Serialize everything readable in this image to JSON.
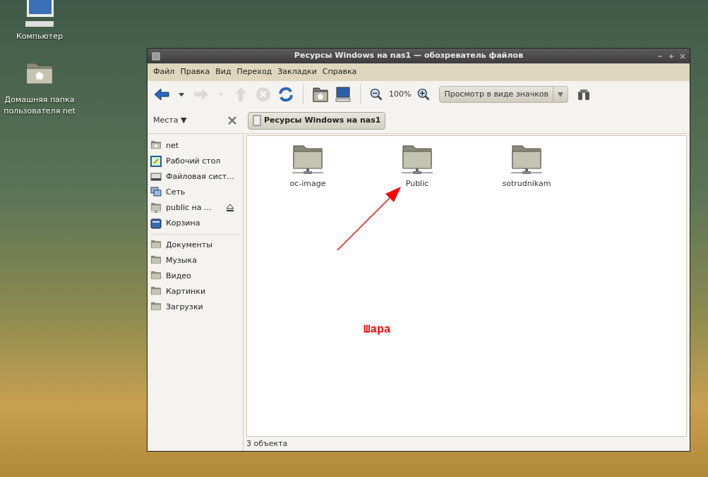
{
  "desktop_icons": [
    {
      "kind": "computer",
      "label": "Компьютер"
    },
    {
      "kind": "home",
      "label": "Домашняя папка пользователя net"
    }
  ],
  "window": {
    "title": "Ресурсы Windows на nas1 — обозреватель файлов"
  },
  "menu": [
    "Файл",
    "Правка",
    "Вид",
    "Переход",
    "Закладки",
    "Справка"
  ],
  "toolbar": [
    [
      {
        "kind": "back",
        "disabled": false
      },
      {
        "kind": "caret",
        "disabled": false
      },
      {
        "kind": "forward",
        "disabled": true
      },
      {
        "kind": "caret",
        "disabled": true
      },
      {
        "kind": "up",
        "disabled": true
      },
      {
        "kind": "stop",
        "disabled": true
      },
      {
        "kind": "reload",
        "disabled": false
      }
    ],
    [
      {
        "kind": "home",
        "disabled": false
      },
      {
        "kind": "computer",
        "disabled": false
      }
    ],
    [
      {
        "kind": "zoom-out",
        "disabled": false
      }
    ]
  ],
  "zoom": "100%",
  "view_select": "Просмотр в виде значков",
  "sidebar": {
    "title": "Места ▼",
    "groups": [
      [
        {
          "kind": "home",
          "label": "net",
          "eject": false
        },
        {
          "kind": "desktop",
          "label": "Рабочий стол",
          "eject": false
        },
        {
          "kind": "drive",
          "label": "Файловая сист…",
          "eject": false
        },
        {
          "kind": "network",
          "label": "Сеть",
          "eject": false
        },
        {
          "kind": "share",
          "label": "public на …",
          "eject": true
        },
        {
          "kind": "trash",
          "label": "Корзина",
          "eject": false
        }
      ],
      [
        {
          "kind": "folder",
          "label": "Документы",
          "eject": false
        },
        {
          "kind": "folder",
          "label": "Музыка",
          "eject": false
        },
        {
          "kind": "folder",
          "label": "Видео",
          "eject": false
        },
        {
          "kind": "folder",
          "label": "Картинки",
          "eject": false
        },
        {
          "kind": "folder",
          "label": "Загрузки",
          "eject": false
        }
      ]
    ]
  },
  "location_button": "Ресурсы Windows на nas1",
  "files": [
    {
      "name": "oc-image",
      "selected": false
    },
    {
      "name": "Public",
      "selected": false
    },
    {
      "name": "sotrudnikam",
      "selected": false
    }
  ],
  "annotation": "Шара",
  "status_bar": "3 объекта"
}
